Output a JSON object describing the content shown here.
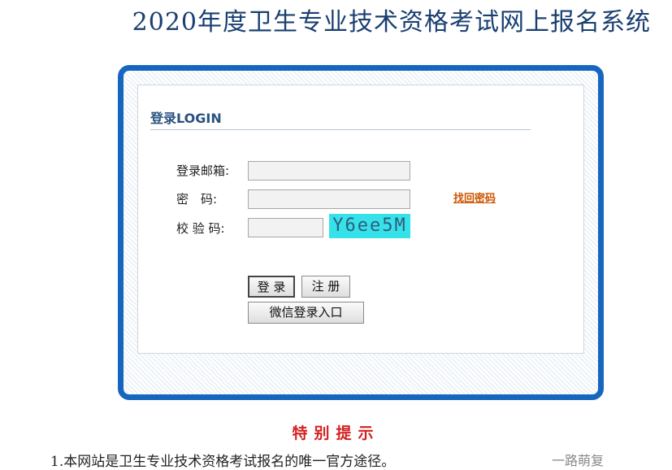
{
  "header": {
    "title": "2020年度卫生专业技术资格考试网上报名系统"
  },
  "login": {
    "heading": "登录LOGIN",
    "email_label": "登录邮箱:",
    "email_value": "",
    "password_label": "密　码:",
    "password_value": "",
    "captcha_label": "校 验 码:",
    "captcha_value": "",
    "captcha_text": "Y6ee5M",
    "forgot_link": "找回密码",
    "login_button": "登 录",
    "register_button": "注 册",
    "wechat_button": "微信登录入口"
  },
  "notice": {
    "title": "特别提示",
    "line1": "1.本网站是卫生专业技术资格考试报名的唯一官方途径。"
  },
  "watermark": {
    "text": "一路萌复"
  }
}
